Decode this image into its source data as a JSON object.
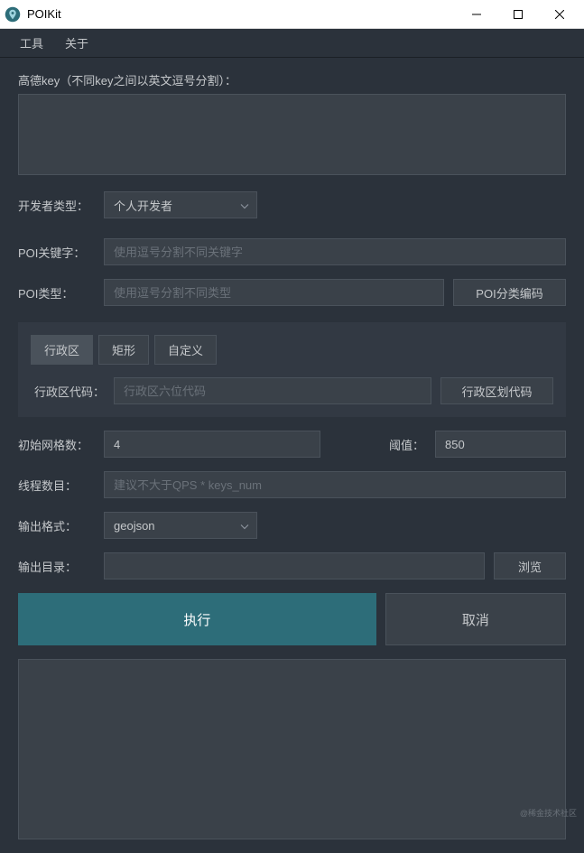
{
  "titlebar": {
    "title": "POIKit"
  },
  "menubar": {
    "tools": "工具",
    "about": "关于"
  },
  "form": {
    "amap_key_label": "高德key（不同key之间以英文逗号分割）：",
    "amap_key_value": "",
    "dev_type_label": "开发者类型：",
    "dev_type_value": "个人开发者",
    "poi_keyword_label": "POI关键字：",
    "poi_keyword_placeholder": "使用逗号分割不同关键字",
    "poi_type_label": "POI类型：",
    "poi_type_placeholder": "使用逗号分割不同类型",
    "poi_type_code_button": "POI分类编码",
    "tabs": {
      "admin": "行政区",
      "rect": "矩形",
      "custom": "自定义"
    },
    "admin_code_label": "行政区代码：",
    "admin_code_placeholder": "行政区六位代码",
    "admin_code_button": "行政区划代码",
    "initial_grid_label": "初始网格数：",
    "initial_grid_value": "4",
    "threshold_label": "阈值：",
    "threshold_value": "850",
    "thread_count_label": "线程数目：",
    "thread_count_placeholder": "建议不大于QPS * keys_num",
    "output_format_label": "输出格式：",
    "output_format_value": "geojson",
    "output_dir_label": "输出目录：",
    "output_dir_value": "",
    "browse_button": "浏览",
    "execute_button": "执行",
    "cancel_button": "取消"
  },
  "watermark": "@稀金技术社区"
}
